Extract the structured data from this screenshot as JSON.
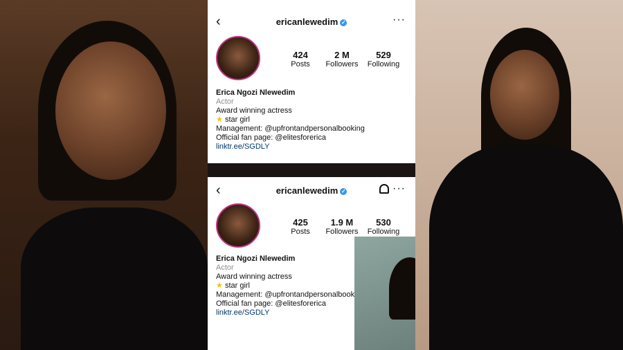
{
  "profiles": [
    {
      "username": "ericanlewedim",
      "posts": "424",
      "posts_label": "Posts",
      "followers": "2 M",
      "followers_label": "Followers",
      "following": "529",
      "following_label": "Following",
      "name": "Erica Ngozi Nlewedim",
      "category": "Actor",
      "bio1": "Award winning actress",
      "bio2": "star girl",
      "bio3": "Management: @upfrontandpersonalbooking",
      "bio4": "Official fan page: @elitesforerica",
      "link": "linktr.ee/SGDLY"
    },
    {
      "username": "ericanlewedim",
      "posts": "425",
      "posts_label": "Posts",
      "followers": "1.9 M",
      "followers_label": "Followers",
      "following": "530",
      "following_label": "Following",
      "name": "Erica Ngozi Nlewedim",
      "category": "Actor",
      "bio1": "Award winning actress",
      "bio2": "star girl",
      "bio3": "Management: @upfrontandpersonalbook",
      "bio4": "Official fan page: @elitesforerica",
      "link": "linktr.ee/SGDLY"
    }
  ],
  "icons": {
    "back": "‹",
    "more": "···",
    "verified": "✓",
    "star": "★"
  }
}
